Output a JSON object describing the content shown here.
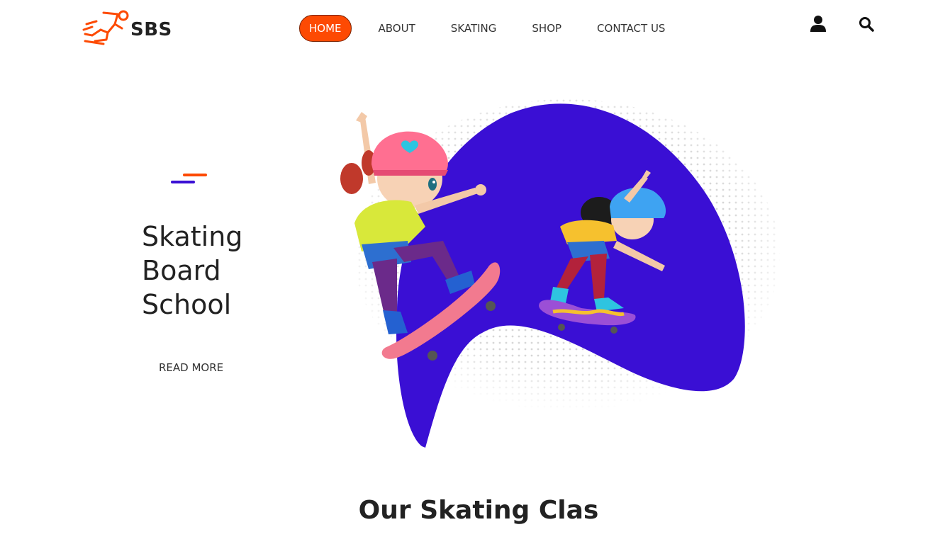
{
  "brand": {
    "name": "SBS",
    "accent_color": "#fd4a03",
    "logo_icon": "skater-icon"
  },
  "nav": {
    "items": [
      {
        "label": "HOME",
        "active": true
      },
      {
        "label": "ABOUT",
        "active": false
      },
      {
        "label": "SKATING",
        "active": false
      },
      {
        "label": "SHOP",
        "active": false
      },
      {
        "label": "CONTACT US",
        "active": false
      }
    ]
  },
  "header_icons": {
    "user": "user-icon",
    "search": "search-icon"
  },
  "hero": {
    "title_lines": [
      "Skating",
      "Board",
      "School"
    ],
    "read_more": "READ MORE",
    "blob_color": "#3a0fd4",
    "illustration": "kids-skateboarding-illustration"
  },
  "section": {
    "title": "Our Skating Clas"
  }
}
